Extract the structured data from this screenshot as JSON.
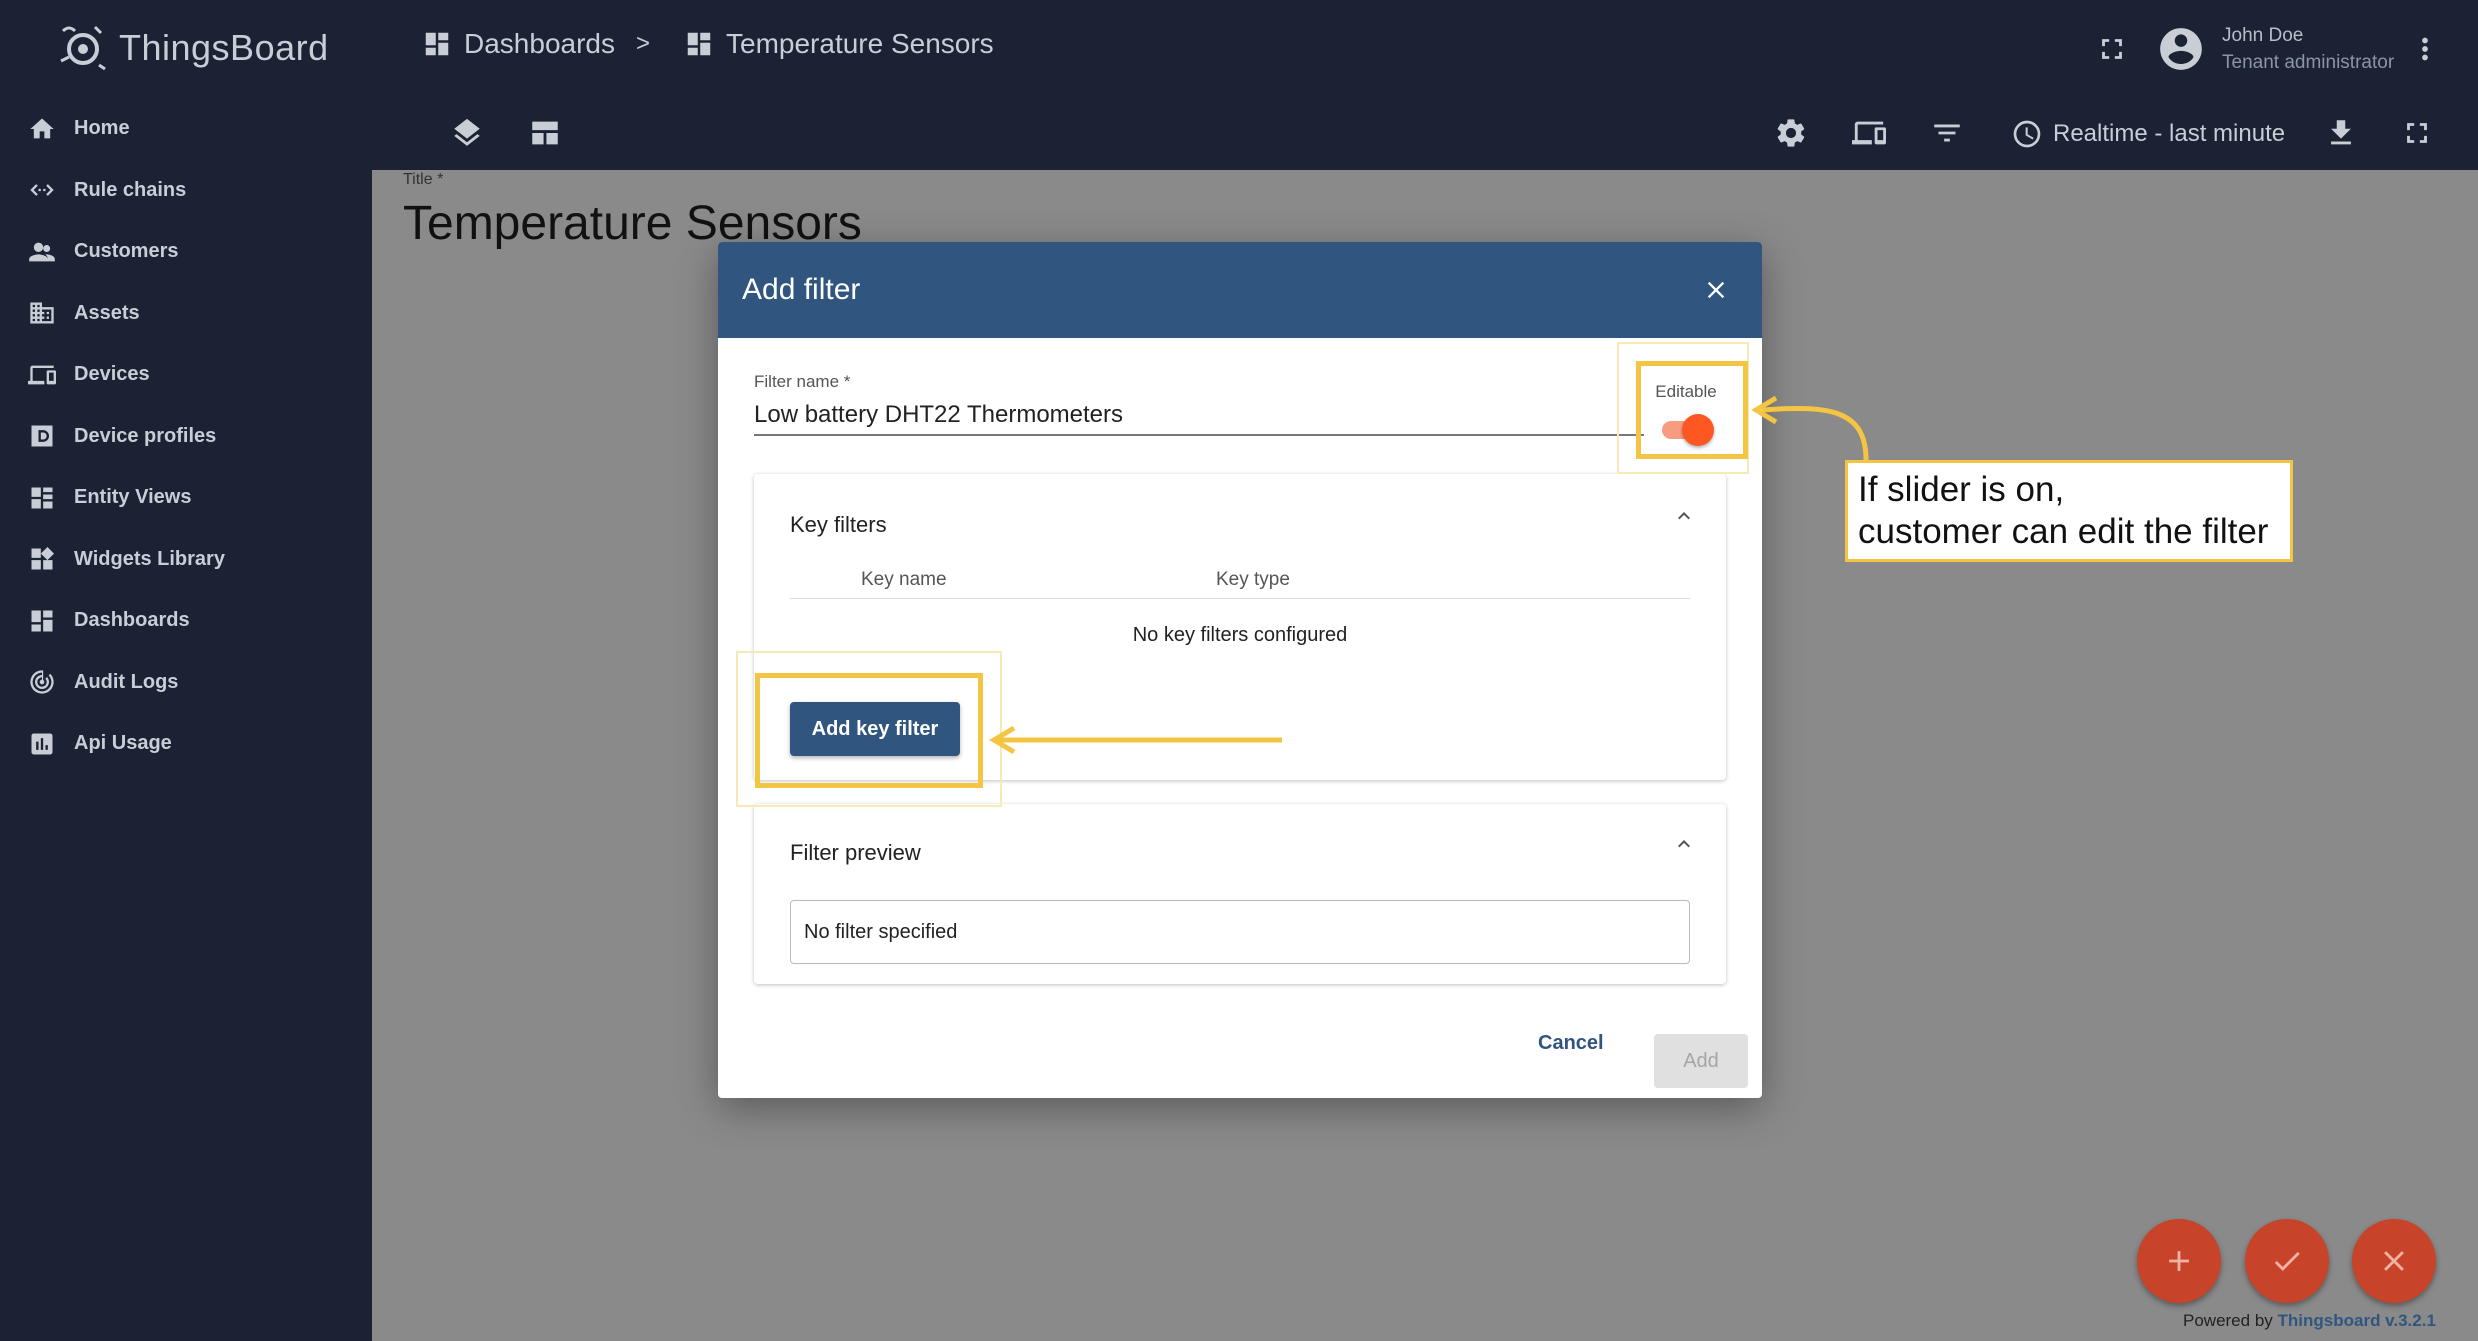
{
  "app": {
    "name": "ThingsBoard"
  },
  "sidebar": {
    "items": [
      {
        "label": "Home",
        "icon": "home-icon"
      },
      {
        "label": "Rule chains",
        "icon": "code-arrows-icon"
      },
      {
        "label": "Customers",
        "icon": "people-icon"
      },
      {
        "label": "Assets",
        "icon": "building-icon"
      },
      {
        "label": "Devices",
        "icon": "devices-icon"
      },
      {
        "label": "Device profiles",
        "icon": "device-profile-icon"
      },
      {
        "label": "Entity Views",
        "icon": "grid-view-icon"
      },
      {
        "label": "Widgets Library",
        "icon": "widgets-icon"
      },
      {
        "label": "Dashboards",
        "icon": "dashboard-icon"
      },
      {
        "label": "Audit Logs",
        "icon": "track-changes-icon"
      },
      {
        "label": "Api Usage",
        "icon": "bar-chart-icon"
      }
    ]
  },
  "header": {
    "breadcrumb": [
      "Dashboards",
      "Temperature Sensors"
    ],
    "separator": ">",
    "user_name": "John Doe",
    "user_role": "Tenant administrator",
    "timewindow": "Realtime - last minute"
  },
  "page": {
    "title_label": "Title *",
    "title": "Temperature Sensors"
  },
  "dialog": {
    "title": "Add filter",
    "filter_name_label": "Filter name *",
    "filter_name_value": "Low battery DHT22 Thermometers",
    "editable_label": "Editable",
    "editable_on": true,
    "key_filters_title": "Key filters",
    "col_key_name": "Key name",
    "col_key_type": "Key type",
    "no_key_filters": "No key filters configured",
    "add_key_filter": "Add key filter",
    "filter_preview_title": "Filter preview",
    "no_filter": "No filter specified",
    "cancel": "Cancel",
    "add": "Add"
  },
  "annotation": {
    "line1": "If slider is on,",
    "line2": "customer can edit the filter"
  },
  "footer": {
    "powered_prefix": "Powered by",
    "powered_link": "Thingsboard v.3.2.1"
  },
  "colors": {
    "sidebar_bg": "#1a2233",
    "primary": "#305680",
    "accent": "#ff5722",
    "highlight": "#f4c542"
  }
}
